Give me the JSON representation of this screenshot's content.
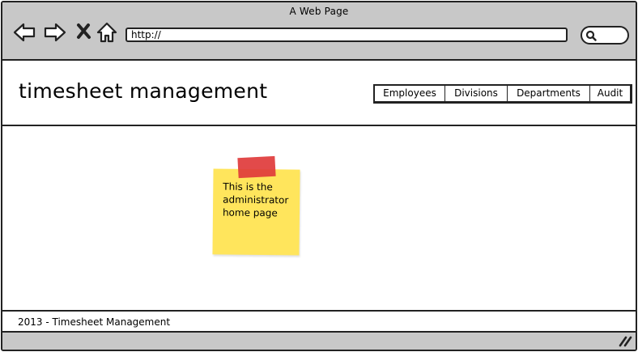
{
  "browser": {
    "window_title": "A Web Page",
    "url": "http://",
    "icons": {
      "back": "back-arrow-icon",
      "forward": "forward-arrow-icon",
      "stop": "close-icon",
      "home": "home-icon",
      "search": "search-icon",
      "resize": "resize-grip-icon"
    }
  },
  "header": {
    "title": "timesheet management",
    "nav": [
      {
        "label": "Employees"
      },
      {
        "label": "Divisions"
      },
      {
        "label": "Departments"
      },
      {
        "label": "Audit"
      }
    ]
  },
  "main": {
    "note_text": "This is the\nadministrator\nhome page",
    "note_color": "#ffe55c",
    "tape_color": "#e03b3b"
  },
  "footer": {
    "text": "2013 - Timesheet Management"
  },
  "colors": {
    "chrome": "#c8c8c8",
    "border": "#222222",
    "background": "#ffffff"
  }
}
